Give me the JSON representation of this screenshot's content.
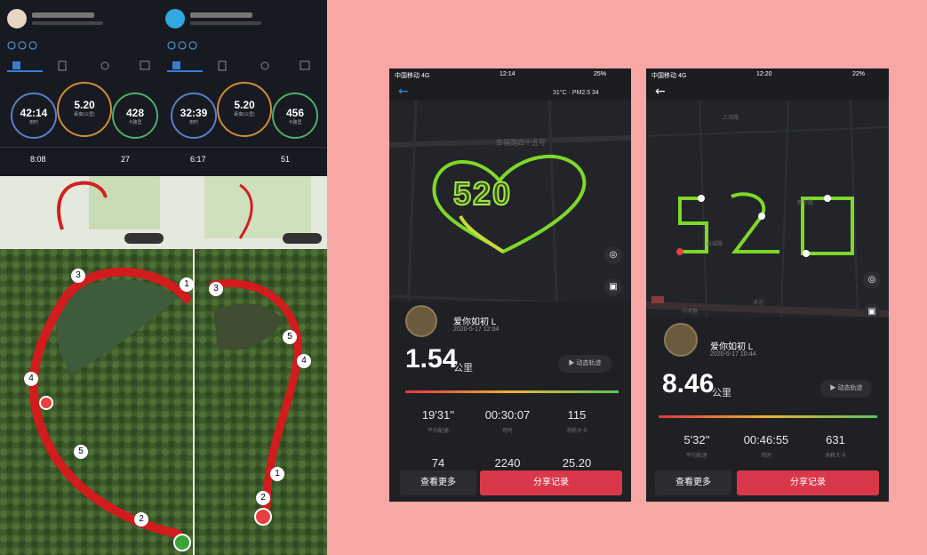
{
  "left_app": {
    "panels": [
      {
        "rings": {
          "left": "42:14",
          "center": "5.20",
          "right": "428"
        },
        "stats": {
          "pace": "8:08",
          "cadence": "27"
        }
      },
      {
        "rings": {
          "left": "32:39",
          "center": "5.20",
          "right": "456"
        },
        "stats": {
          "pace": "6:17",
          "cadence": "51"
        }
      }
    ],
    "route_markers_left": [
      "3",
      "1",
      "4",
      "5",
      "2"
    ],
    "route_markers_right": [
      "3",
      "5",
      "4",
      "1",
      "2"
    ]
  },
  "phone1": {
    "status": {
      "carrier": "中国移动 4G",
      "time": "12:14",
      "battery": "25%"
    },
    "weather": "31°C · PM2.5 34",
    "street": "幸福路四十五号",
    "heart_text": "520",
    "user": {
      "name": "爱你如初 L",
      "date": "2020-5-17 12:04"
    },
    "distance": "1.54",
    "unit": "公里",
    "playback": "▶ 动态轨迹",
    "stats": [
      {
        "value": "19'31''",
        "label": "平均配速"
      },
      {
        "value": "00:30:07",
        "label": "用时"
      },
      {
        "value": "115",
        "label": "消耗大卡"
      }
    ],
    "stats2": [
      "74",
      "2240",
      "25.20"
    ],
    "buttons": {
      "more": "查看更多",
      "share": "分享记录"
    }
  },
  "phone2": {
    "status": {
      "carrier": "中国移动 4G",
      "time": "12:20",
      "battery": "22%"
    },
    "streets": [
      "上海路",
      "新华路",
      "东城路",
      "小河港",
      "沭河"
    ],
    "user": {
      "name": "爱你如初 L",
      "date": "2020-5-17 10:44"
    },
    "distance": "8.46",
    "unit": "公里",
    "playback": "▶ 动态轨迹",
    "stats": [
      {
        "value": "5'32''",
        "label": "平均配速"
      },
      {
        "value": "00:46:55",
        "label": "用时"
      },
      {
        "value": "631",
        "label": "消耗大卡"
      }
    ],
    "buttons": {
      "more": "查看更多",
      "share": "分享记录"
    }
  }
}
